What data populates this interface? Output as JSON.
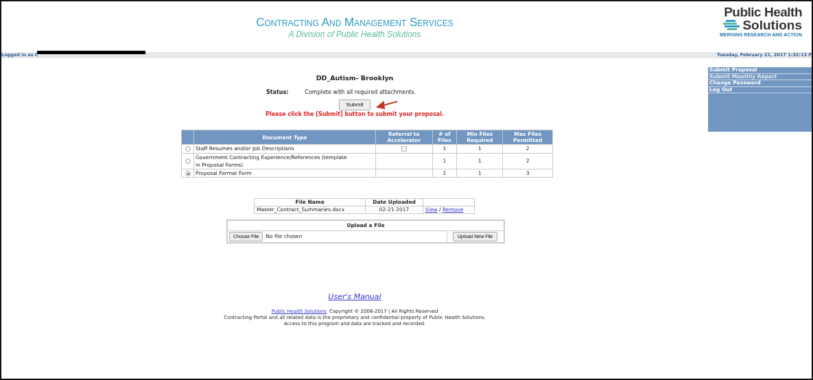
{
  "header": {
    "title": "Contracting And Management Services",
    "subtitle": "A Division of Public Health Solutions",
    "logo": {
      "line1": "Public Health",
      "line2": "Solutions",
      "tagline": "MERGING RESEARCH AND ACTION"
    }
  },
  "status_bar": {
    "login": "Logged in as C",
    "redacted": true,
    "datetime": "Tuesday, February 21, 2017 1:32:13 P"
  },
  "menu": [
    {
      "label": "Submit Proposal",
      "disabled": false
    },
    {
      "label": "Submit Monthly Report",
      "disabled": true
    },
    {
      "label": "Change Password",
      "disabled": false
    },
    {
      "label": "Log Out",
      "disabled": false
    }
  ],
  "proposal": {
    "title": "DD_Autism- Brooklyn",
    "status_label": "Status:",
    "status": "Complete with all required attachments.",
    "submit": "Submit",
    "warning": "Please click the [Submit] button to submit your proposal."
  },
  "documents": {
    "columns": [
      "Document Type",
      "Referral to Accelerator",
      "# of Files",
      "Min Files Required",
      "Max Files Permitted"
    ],
    "rows": [
      {
        "selected": false,
        "type": "Staff Resumes and/or Job Descriptions",
        "referral_checkbox": true,
        "files": "1",
        "min": "1",
        "max": "2"
      },
      {
        "selected": false,
        "type": "Government Contracting Experience/References (template in Proposal Forms)",
        "referral_checkbox": false,
        "files": "1",
        "min": "1",
        "max": "2"
      },
      {
        "selected": true,
        "type": "Proposal Format Form",
        "referral_checkbox": false,
        "files": "1",
        "min": "1",
        "max": "3"
      }
    ]
  },
  "files": {
    "columns": [
      "File Name",
      "Date Uploaded"
    ],
    "rows": [
      {
        "name": "Master_Contract_Summaries.docx",
        "date": "02-21-2017",
        "view": "View",
        "sep": "/",
        "remove": "Remove"
      }
    ]
  },
  "upload": {
    "title": "Upload a File",
    "choose": "Choose File",
    "chosen": "No file chosen",
    "button": "Upload New File"
  },
  "footer": {
    "manual": "User's Manual",
    "company_link": "Public Health Solutions",
    "copyright": "Copyright © 2006-2017 | All Rights Reserved",
    "line2": "Contracting Portal and all related data is the proprietary and confidential property of Public Health Solutions.",
    "line3": "Access to this program and data are tracked and recorded."
  }
}
